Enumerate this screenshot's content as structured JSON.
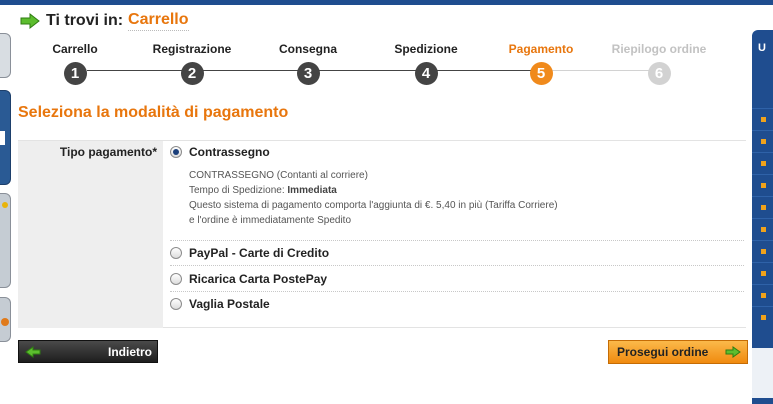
{
  "breadcrumb": {
    "label": "Ti trovi in:",
    "current": "Carrello"
  },
  "steps": [
    {
      "label": "Carrello",
      "number": "1",
      "state": "done"
    },
    {
      "label": "Registrazione",
      "number": "2",
      "state": "done"
    },
    {
      "label": "Consegna",
      "number": "3",
      "state": "done"
    },
    {
      "label": "Spedizione",
      "number": "4",
      "state": "done"
    },
    {
      "label": "Pagamento",
      "number": "5",
      "state": "active"
    },
    {
      "label": "Riepilogo ordine",
      "number": "6",
      "state": "disabled"
    }
  ],
  "section_title": "Seleziona la modalità di pagamento",
  "payment": {
    "field_label": "Tipo pagamento*",
    "options": [
      {
        "label": "Contrassegno",
        "selected": true
      },
      {
        "label": "PayPal - Carte di Credito",
        "selected": false
      },
      {
        "label": "Ricarica Carta PostePay",
        "selected": false
      },
      {
        "label": "Vaglia Postale",
        "selected": false
      }
    ],
    "description": {
      "line1": "CONTRASSEGNO (Contanti al corriere)",
      "line2_prefix": "Tempo di Spedizione: ",
      "line2_value": "Immediata",
      "line3": "Questo sistema di pagamento comporta l'aggiunta di €. 5,40 in più (Tariffa Corriere)",
      "line4": "e l'ordine è immediatamente Spedito"
    }
  },
  "buttons": {
    "back": "Indietro",
    "next": "Prosegui ordine"
  },
  "right_panel": {
    "header": "U"
  },
  "colors": {
    "accent": "#e8760d",
    "step_done": "#444444",
    "step_active": "#f08a1c",
    "step_disabled": "#d2d2d2",
    "header_blue": "#1f4d8f",
    "arrow_green": "#4caf2a"
  },
  "icons": {
    "breadcrumb": "green-arrow-right-icon",
    "back": "green-arrow-left-icon",
    "next": "green-arrow-right-icon"
  }
}
